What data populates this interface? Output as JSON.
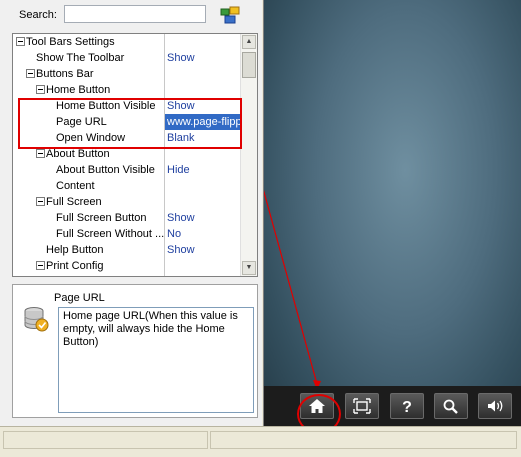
{
  "search": {
    "label": "Search:",
    "value": ""
  },
  "tree": {
    "rows": [
      {
        "name": "Tool Bars Settings",
        "value": "",
        "level": 0,
        "expander": true
      },
      {
        "name": "Show The Toolbar",
        "value": "Show",
        "level": 1,
        "expander": false
      },
      {
        "name": "Buttons Bar",
        "value": "",
        "level": 1,
        "expander": true
      },
      {
        "name": "Home Button",
        "value": "",
        "level": 2,
        "expander": true
      },
      {
        "name": "Home Button Visible",
        "value": "Show",
        "level": 3,
        "expander": false
      },
      {
        "name": "Page URL",
        "value": "www.page-flipp",
        "level": 3,
        "expander": false,
        "selected": true
      },
      {
        "name": "Open Window",
        "value": "Blank",
        "level": 3,
        "expander": false
      },
      {
        "name": "About Button",
        "value": "",
        "level": 2,
        "expander": true
      },
      {
        "name": "About Button Visible",
        "value": "Hide",
        "level": 3,
        "expander": false
      },
      {
        "name": "Content",
        "value": "",
        "level": 3,
        "expander": false
      },
      {
        "name": "Full Screen",
        "value": "",
        "level": 2,
        "expander": true
      },
      {
        "name": "Full Screen Button",
        "value": "Show",
        "level": 3,
        "expander": false
      },
      {
        "name": "Full Screen Without ...",
        "value": "No",
        "level": 3,
        "expander": false
      },
      {
        "name": "Help Button",
        "value": "Show",
        "level": 2,
        "expander": false
      },
      {
        "name": "Print Config",
        "value": "",
        "level": 2,
        "expander": true
      }
    ]
  },
  "description": {
    "title": "Page URL",
    "text": "Home page URL(When this value is empty, will always hide the Home Button)"
  },
  "toolbar": {
    "buttons": [
      {
        "name": "home-button",
        "icon": "home-icon"
      },
      {
        "name": "fullscreen-button",
        "icon": "fullscreen-icon"
      },
      {
        "name": "help-button",
        "icon": "question-icon"
      },
      {
        "name": "zoom-button",
        "icon": "magnifier-icon"
      },
      {
        "name": "sound-button",
        "icon": "speaker-icon"
      }
    ]
  },
  "colors": {
    "highlight": "#e00000",
    "selection": "#316ac5",
    "value_text": "#1f3f9f"
  }
}
